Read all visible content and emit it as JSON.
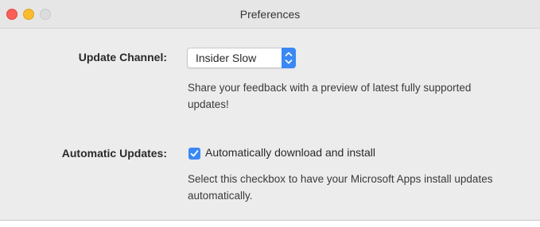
{
  "window": {
    "title": "Preferences"
  },
  "update_channel": {
    "label": "Update Channel:",
    "selected": "Insider Slow",
    "description": "Share your feedback with a preview of latest fully supported updates!"
  },
  "automatic_updates": {
    "label": "Automatic Updates:",
    "checkbox_label": "Automatically download and install",
    "checked": true,
    "description": "Select this checkbox to have your Microsoft Apps install updates automatically."
  },
  "colors": {
    "accent": "#3a88f5",
    "close": "#fc5f57",
    "minimize": "#fdbc2e",
    "zoom_inactive": "#dcdcdc"
  },
  "icons": {
    "stepper": "up-down-chevron-icon",
    "check": "checkmark-icon"
  }
}
